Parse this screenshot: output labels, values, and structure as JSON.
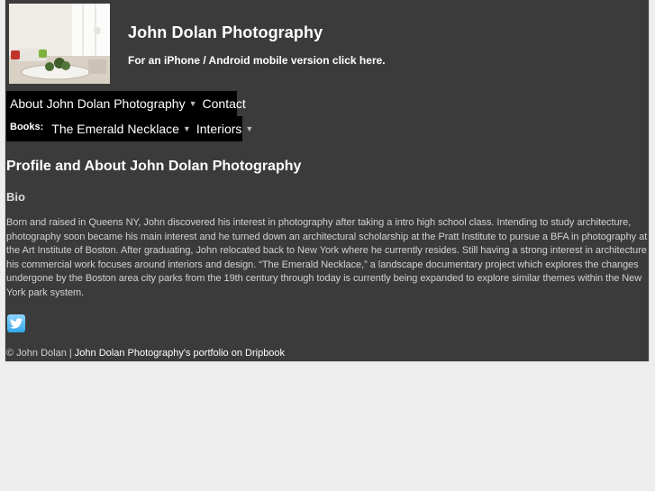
{
  "site": {
    "title": "John Dolan Photography",
    "mobile_link": "For an iPhone / Android mobile version click here."
  },
  "nav": {
    "items": [
      {
        "label": "About John Dolan Photography",
        "caret": "▼"
      },
      {
        "label": "Contact"
      }
    ],
    "books_label": "Books:",
    "books": [
      {
        "label": "The Emerald Necklace",
        "caret": "▼"
      },
      {
        "label": "Interiors",
        "caret": "▼"
      }
    ]
  },
  "main": {
    "heading": "Profile and About John Dolan Photography",
    "bio_heading": "Bio",
    "bio_text": "Born and raised in Queens NY, John discovered his interest in photography after taking a intro high school class. Intending to study architecture, photography soon became his main interest and he turned down an architectural scholarship at the Pratt Institute to pursue a BFA in photography at the Art Institute of Boston. After graduating, John relocated back to New York where he currently resides. Still having a strong interest in architecture his commercial work focuses around interiors and design. “The Emerald Necklace,” a landscape documentary project which explores the changes undergone by the Boston area city parks from the 19th century through today is currently being expanded to explore similar themes within the New York park system."
  },
  "social": {
    "twitter_icon": "twitter-bird-icon"
  },
  "footer": {
    "copyright": "© John Dolan",
    "separator": "|",
    "portfolio_link": "John Dolan Photography's portfolio on Dripbook"
  },
  "colors": {
    "page_background": "#efeeef",
    "content_background": "#3b3b3b",
    "nav_background": "#000000",
    "twitter_blue": "#33a8ea"
  }
}
